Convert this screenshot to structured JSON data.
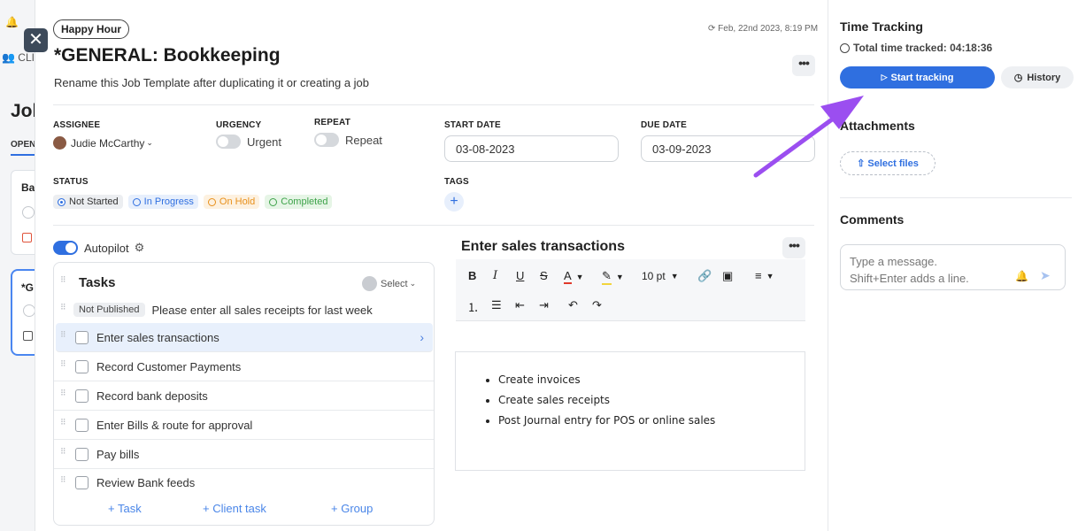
{
  "background": {
    "clients_label": "CLI",
    "heading": "Jol",
    "open_tab": "OPEN",
    "card1_title": "Ba",
    "card2_title": "*G"
  },
  "job": {
    "chip": "Happy Hour",
    "date_stamp": "Feb, 22nd 2023, 8:19 PM",
    "title": "*GENERAL: Bookkeeping",
    "description": "Rename this Job Template after duplicating it or creating a job",
    "more": "•••"
  },
  "fields": {
    "assignee_label": "ASSIGNEE",
    "assignee_value": "Judie McCarthy",
    "urgency_label": "URGENCY",
    "urgency_value": "Urgent",
    "repeat_label": "REPEAT",
    "repeat_value": "Repeat",
    "start_date_label": "START DATE",
    "start_date_value": "03-08-2023",
    "due_date_label": "DUE DATE",
    "due_date_value": "03-09-2023",
    "status_label": "STATUS",
    "tags_label": "TAGS",
    "tags_add": "+"
  },
  "statuses": [
    {
      "label": "Not Started",
      "color": "#333333",
      "bg": "#eceef1",
      "selected": true
    },
    {
      "label": "In Progress",
      "color": "#2f6fe0",
      "bg": "#e7effc",
      "selected": false
    },
    {
      "label": "On Hold",
      "color": "#e8901b",
      "bg": "#fdf1e0",
      "selected": false
    },
    {
      "label": "Completed",
      "color": "#3ea34a",
      "bg": "#e6f5e6",
      "selected": false
    }
  ],
  "autopilot": {
    "label": "Autopilot",
    "on": true
  },
  "tasks": {
    "title": "Tasks",
    "select_label": "Select",
    "not_published_badge": "Not Published",
    "not_published_text": "Please enter all sales receipts for last week",
    "items": [
      {
        "label": "Enter sales transactions",
        "active": true
      },
      {
        "label": "Record Customer Payments",
        "active": false
      },
      {
        "label": "Record bank deposits",
        "active": false
      },
      {
        "label": "Enter Bills & route for approval",
        "active": false
      },
      {
        "label": "Pay bills",
        "active": false
      },
      {
        "label": "Review Bank feeds",
        "active": false
      }
    ],
    "add_task": "+ Task",
    "add_client_task": "+ Client task",
    "add_group": "+ Group"
  },
  "editor": {
    "title": "Enter sales transactions",
    "font_size": "10 pt",
    "bullets": [
      "Create invoices",
      "Create sales receipts",
      "Post Journal entry for POS or online sales"
    ]
  },
  "time_tracking": {
    "title": "Time Tracking",
    "total_label": "Total time tracked: 04:18:36",
    "start_button": "Start tracking",
    "history_button": "History"
  },
  "attachments": {
    "title": "Attachments",
    "select_files": "Select files"
  },
  "comments": {
    "title": "Comments",
    "placeholder_line1": "Type a message.",
    "placeholder_line2": "Shift+Enter adds a line."
  },
  "colors": {
    "accent": "#2f6fe0",
    "annotation_arrow": "#9b4ef0"
  }
}
